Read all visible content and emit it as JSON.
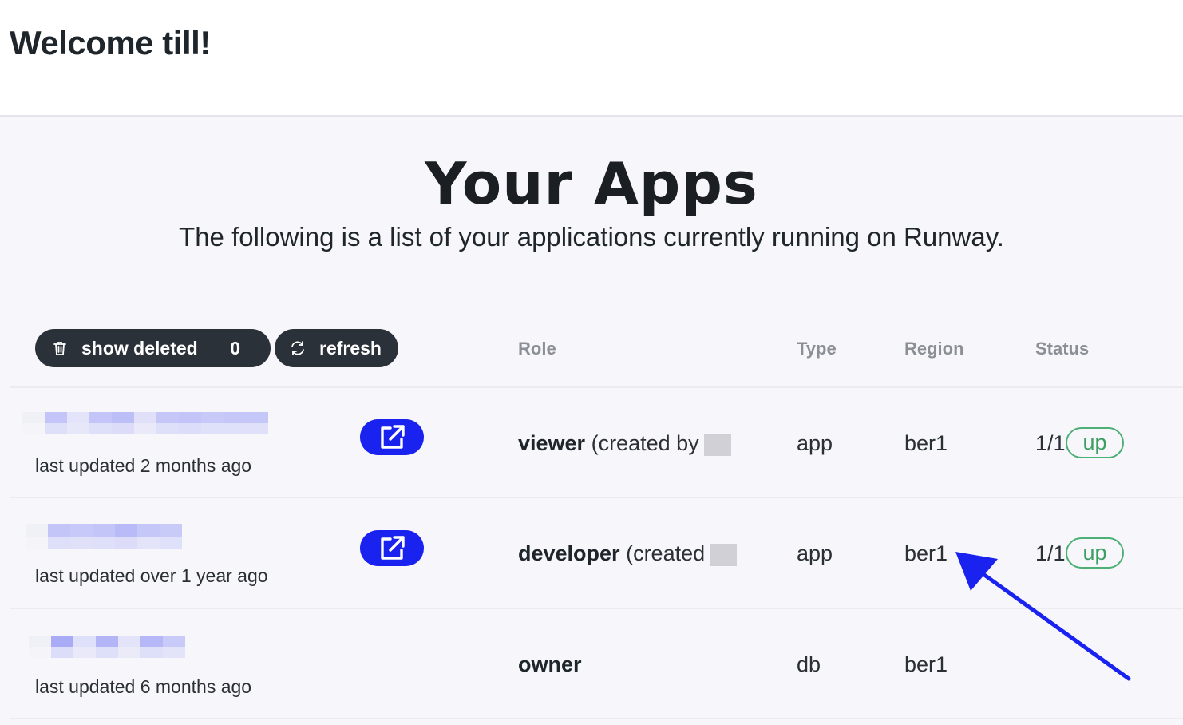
{
  "header": {
    "welcome": "Welcome till!"
  },
  "page": {
    "title": "Your Apps",
    "subtitle": "The following is a list of your applications currently running on Runway."
  },
  "toolbar": {
    "show_deleted_label": "show deleted",
    "show_deleted_count": "0",
    "refresh_label": "refresh"
  },
  "columns": {
    "role": "Role",
    "type": "Type",
    "region": "Region",
    "status": "Status"
  },
  "apps": [
    {
      "updated": "last updated 2 months ago",
      "role": "viewer",
      "role_suffix": "(created by",
      "type": "app",
      "region": "ber1",
      "instances": "1/1",
      "status": "up"
    },
    {
      "updated": "last updated over 1 year ago",
      "role": "developer",
      "role_suffix": "(created",
      "type": "app",
      "region": "ber1",
      "instances": "1/1",
      "status": "up"
    },
    {
      "updated": "last updated 6 months ago",
      "role": "owner",
      "role_suffix": "",
      "type": "db",
      "region": "ber1",
      "instances": "",
      "status": ""
    }
  ],
  "colors": {
    "accent": "#1a22f0",
    "status_up": "#3d9e63",
    "dark_button": "#2b3138",
    "annotation_arrow": "#1a22f0"
  },
  "icons": {
    "trash": "trash-icon",
    "refresh": "refresh-icon",
    "open": "external-link-icon"
  }
}
